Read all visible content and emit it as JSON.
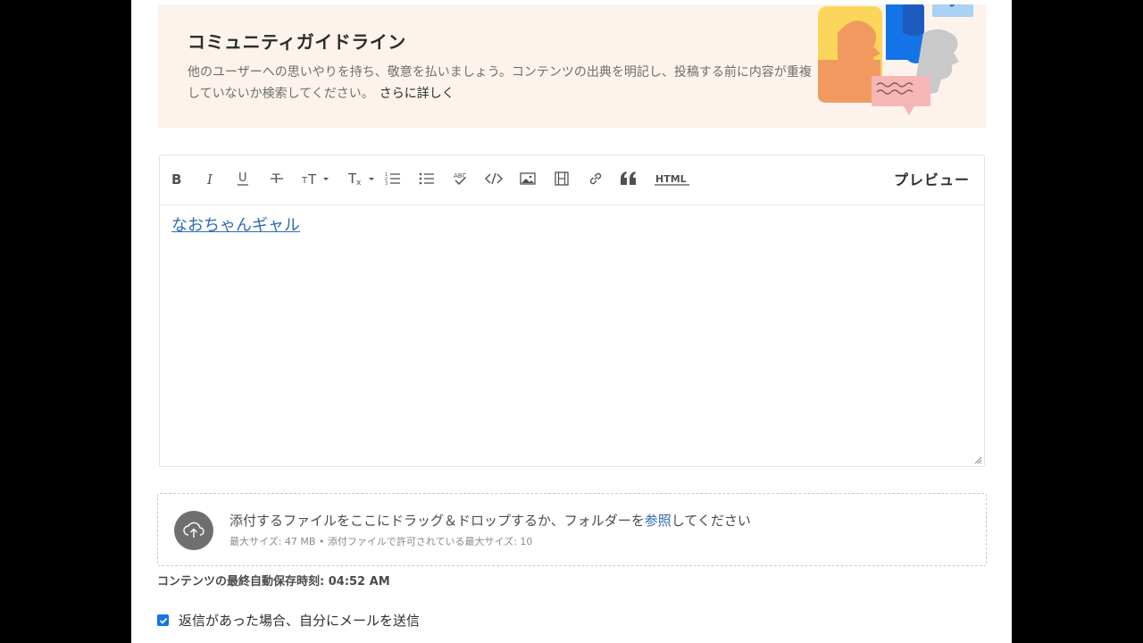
{
  "guidelines": {
    "title": "コミュニティガイドライン",
    "description": "他のユーザーへの思いやりを持ち、敬意を払いましょう。コンテンツの出典を明記し、投稿する前に内容が重複していないか検索してください。",
    "more_link": "さらに詳しく"
  },
  "editor": {
    "toolbar": {
      "icons": [
        "bold-icon",
        "italic-icon",
        "underline-icon",
        "strikethrough-icon",
        "font-size-icon",
        "clear-format-icon",
        "ordered-list-icon",
        "unordered-list-icon",
        "spellcheck-icon",
        "code-icon",
        "image-icon",
        "video-icon",
        "link-icon",
        "quote-icon",
        "html-icon"
      ],
      "html_label": "HTML",
      "preview_label": "プレビュー"
    },
    "content_link": "なおちゃんギャル"
  },
  "attachments": {
    "prompt_before": "添付するファイルをここにドラッグ＆ドロップするか、フォルダーを",
    "browse_label": "参照",
    "prompt_after": "してください",
    "limits": "最大サイズ: 47 MB • 添付ファイルで許可されている最大サイズ: 10"
  },
  "autosave": {
    "text": "コンテンツの最終自動保存時刻: 04:52 AM"
  },
  "notify": {
    "checked": true,
    "label": "返信があった場合、自分にメールを送信"
  },
  "colors": {
    "banner_bg": "#fdf3ec",
    "link": "#2b6cb0",
    "checkbox": "#1473e6"
  }
}
